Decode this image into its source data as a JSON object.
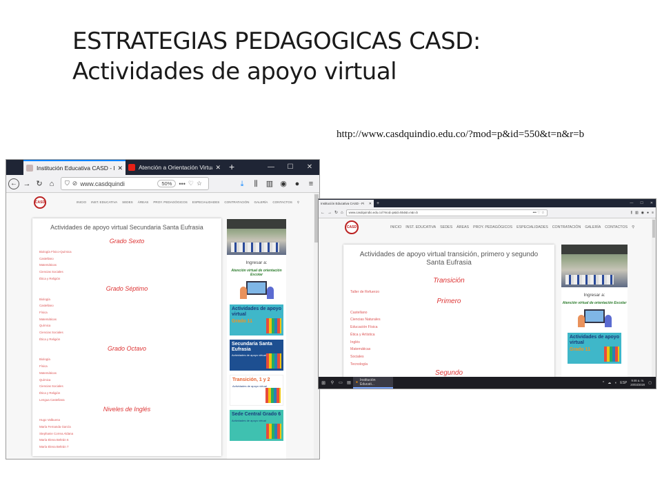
{
  "slide": {
    "title_line1": "ESTRATEGIAS PEDAGOGICAS CASD:",
    "title_line2": "Actividades de apoyo virtual",
    "url_caption": "http://www.casdquindio.edu.co/?mod=p&id=550&t=n&r=b"
  },
  "colors": {
    "accent_red": "#d33333",
    "tabbar": "#1f2535",
    "link": "#dd5555"
  },
  "shot1": {
    "tabs": [
      {
        "label": "Institución Educativa CASD - Pi"
      },
      {
        "label": "Atención a Orientación Virtual"
      }
    ],
    "url": "www.casdquindi",
    "zoom": "50%",
    "menu": [
      "INICIO",
      "INST. EDUCATIVA",
      "SEDES",
      "ÁREAS",
      "PROY. PEDAGÓGICOS",
      "ESPECIALIDADES",
      "CONTRATACIÓN",
      "GALERÍA",
      "CONTACTOS"
    ],
    "card_title": "Actividades de apoyo virtual Secundaria Santa Eufrasia",
    "sections": [
      {
        "grade": "Grado Sexto",
        "links": [
          "Biología Físico-Química",
          "Castellano",
          "Matemáticas",
          "Ciencias Sociales",
          "Ética y Religión"
        ]
      },
      {
        "grade": "Grado Séptimo",
        "links": [
          "Biología",
          "Castellano",
          "Física",
          "Matemáticas",
          "Química",
          "Ciencias Sociales",
          "Ética y Religión"
        ]
      },
      {
        "grade": "Grado Octavo",
        "links": [
          "Biología",
          "Física",
          "Matemáticas",
          "Química",
          "Ciencias Sociales",
          "Ética y Religión",
          "Lengua Castellana"
        ]
      },
      {
        "grade": "Niveles de Inglés",
        "links": [
          "Hugo Valbuena",
          "María Fernanda García",
          "Stephanie Correa Aldana",
          "María Elena Beltrán 6",
          "María Elena Beltrán 7"
        ]
      }
    ],
    "side": {
      "ingresar": "Ingresar a:",
      "atencion": "Atención virtual de orientación Escolar",
      "banner_actividades": "Actividades de apoyo virtual",
      "banner_actividades_grade": "Grado 11",
      "banner_secundaria": "Secundaria Santa Eufrasia",
      "banner_secundaria_sub": "Actividades de apoyo virtual",
      "banner_transicion": "Transición, 1 y 2",
      "banner_transicion_sub": "Actividades de apoyo virtual",
      "banner_sede": "Sede Central Grado 6",
      "banner_sede_sub": "Actividades de apoyo virtual"
    }
  },
  "shot2": {
    "tab": "Institución Educativa CASD - Pi",
    "url": "www.casdquindio.edu.co/?mod=p&id=554&t=n&r=b",
    "menu": [
      "INICIO",
      "INST. EDUCATIVA",
      "SEDES",
      "ÁREAS",
      "PROY. PEDAGÓGICOS",
      "ESPECIALIDADES",
      "CONTRATACIÓN",
      "GALERÍA",
      "CONTACTOS"
    ],
    "card_title": "Actividades de apoyo virtual transición, primero y segundo Santa Eufrasia",
    "sections": [
      {
        "grade": "Transición",
        "links": [
          "Taller de Refuerzo"
        ]
      },
      {
        "grade": "Primero",
        "links": [
          "Castellano",
          "Ciencias Naturales",
          "Educación Física",
          "Ética y Artística",
          "Inglés",
          "Matemáticas",
          "Sociales",
          "Tecnología"
        ]
      },
      {
        "grade": "Segundo",
        "links": []
      }
    ],
    "side": {
      "ingresar": "Ingresar a:",
      "atencion": "Atención virtual de orientación Escolar",
      "banner_actividades": "Actividades de apoyo virtual",
      "banner_actividades_grade": "Grado 11"
    },
    "taskbar": {
      "app_label": "Institución Educati...",
      "lang": "ESP",
      "time": "9:46 a. m.",
      "date": "20/03/2020"
    }
  }
}
